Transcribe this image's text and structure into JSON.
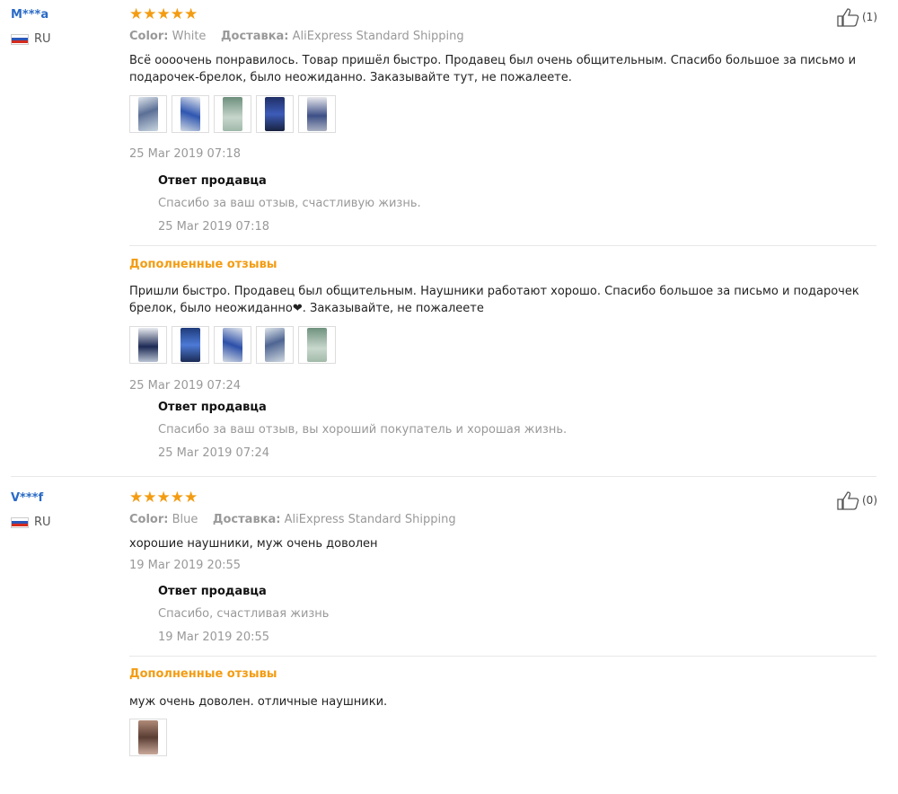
{
  "reviews": [
    {
      "user": "M***a",
      "country": "RU",
      "stars": "★★★★★",
      "color_label": "Color:",
      "color_value": "White",
      "shipping_label": "Доставка:",
      "shipping_value": "AliExpress Standard Shipping",
      "likes": "(1)",
      "text": "Всё оооочень понравилось. Товар пришёл быстро. Продавец был очень общительным. Спасибо большое за письмо и подарочек-брелок, было неожиданно. Заказывайте тут, не пожалеете.",
      "date": "25 Mar 2019 07:18",
      "reply": {
        "title": "Ответ продавца",
        "text": "Спасибо за ваш отзыв, счастливую жизнь.",
        "date": "25 Mar 2019 07:18"
      },
      "followup": {
        "title": "Дополненные отзывы",
        "text": "Пришли быстро. Продавец был общительным. Наушники работают хорошо. Спасибо большое за письмо и подарочек брелок, было неожиданно❤. Заказывайте, не пожалеете",
        "date": "25 Mar 2019 07:24",
        "reply": {
          "title": "Ответ продавца",
          "text": "Спасибо за ваш отзыв, вы хороший покупатель и хорошая жизнь.",
          "date": "25 Mar 2019 07:24"
        }
      }
    },
    {
      "user": "V***f",
      "country": "RU",
      "stars": "★★★★★",
      "color_label": "Color:",
      "color_value": "Blue",
      "shipping_label": "Доставка:",
      "shipping_value": "AliExpress Standard Shipping",
      "likes": "(0)",
      "text": "хорошие наушники, муж очень доволен",
      "date": "19 Mar 2019 20:55",
      "reply": {
        "title": "Ответ продавца",
        "text": "Спасибо, счастливая жизнь",
        "date": "19 Mar 2019 20:55"
      },
      "followup": {
        "title": "Дополненные отзывы",
        "text": "муж очень доволен. отличные наушники."
      }
    }
  ],
  "colors": {
    "user": "#2a6bc6",
    "stars": "#f39c12",
    "followup": "#f39c12",
    "muted": "#999999"
  }
}
